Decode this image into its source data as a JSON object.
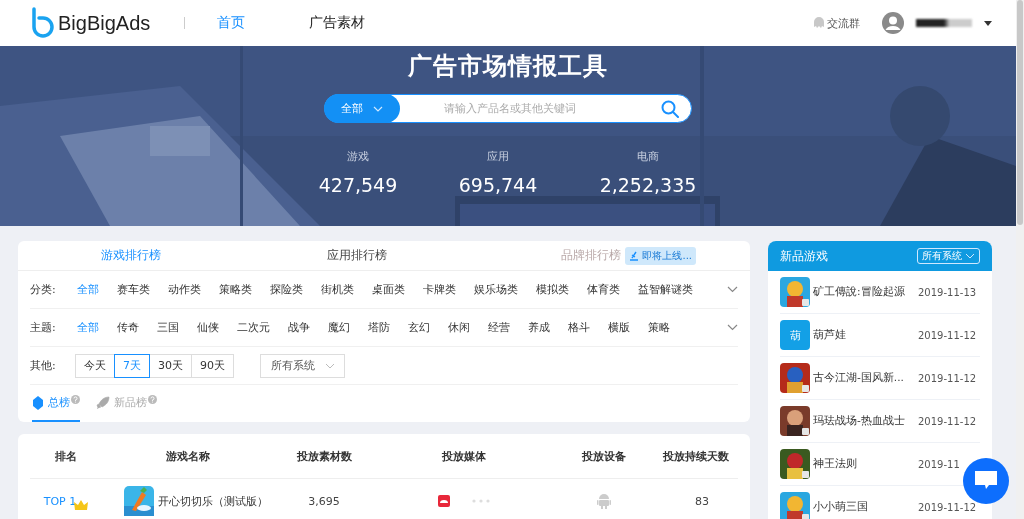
{
  "nav": {
    "logo": "BigBigAds",
    "items": [
      {
        "label": "首页",
        "selected": true
      },
      {
        "label": "广告素材",
        "selected": false
      }
    ],
    "group_chat": "交流群"
  },
  "hero": {
    "title": "广告市场情报工具",
    "search": {
      "scope": "全部",
      "placeholder": "请输入产品名或其他关键词"
    },
    "stats": [
      {
        "label": "游戏",
        "value": "427,549"
      },
      {
        "label": "应用",
        "value": "695,744"
      },
      {
        "label": "电商",
        "value": "2,252,335"
      }
    ]
  },
  "rank_tabs": [
    {
      "label": "游戏排行榜",
      "selected": true,
      "disabled": false
    },
    {
      "label": "应用排行榜",
      "selected": false,
      "disabled": false
    },
    {
      "label": "品牌排行榜",
      "selected": false,
      "disabled": true,
      "badge": "即将上线..."
    }
  ],
  "filters": [
    {
      "label": "分类:",
      "options": [
        {
          "label": "全部",
          "selected": true
        },
        {
          "label": "赛车类",
          "selected": false
        },
        {
          "label": "动作类",
          "selected": false
        },
        {
          "label": "策略类",
          "selected": false
        },
        {
          "label": "探险类",
          "selected": false
        },
        {
          "label": "街机类",
          "selected": false
        },
        {
          "label": "桌面类",
          "selected": false
        },
        {
          "label": "卡牌类",
          "selected": false
        },
        {
          "label": "娱乐场类",
          "selected": false
        },
        {
          "label": "模拟类",
          "selected": false
        },
        {
          "label": "体育类",
          "selected": false
        },
        {
          "label": "益智解谜类",
          "selected": false
        }
      ]
    },
    {
      "label": "主题:",
      "options": [
        {
          "label": "全部",
          "selected": true
        },
        {
          "label": "传奇",
          "selected": false
        },
        {
          "label": "三国",
          "selected": false
        },
        {
          "label": "仙侠",
          "selected": false
        },
        {
          "label": "二次元",
          "selected": false
        },
        {
          "label": "战争",
          "selected": false
        },
        {
          "label": "魔幻",
          "selected": false
        },
        {
          "label": "塔防",
          "selected": false
        },
        {
          "label": "玄幻",
          "selected": false
        },
        {
          "label": "休闲",
          "selected": false
        },
        {
          "label": "经营",
          "selected": false
        },
        {
          "label": "养成",
          "selected": false
        },
        {
          "label": "格斗",
          "selected": false
        },
        {
          "label": "横版",
          "selected": false
        },
        {
          "label": "策略",
          "selected": false
        }
      ]
    }
  ],
  "other": {
    "label": "其他:",
    "periods": [
      {
        "label": "今天",
        "selected": false
      },
      {
        "label": "7天",
        "selected": true
      },
      {
        "label": "30天",
        "selected": false
      },
      {
        "label": "90天",
        "selected": false
      }
    ],
    "system": "所有系统"
  },
  "sub_tabs": [
    {
      "label": "总榜",
      "selected": true
    },
    {
      "label": "新品榜",
      "selected": false
    }
  ],
  "table": {
    "columns": [
      "排名",
      "游戏名称",
      "投放素材数",
      "投放媒体",
      "投放设备",
      "投放持续天数"
    ],
    "rows": [
      {
        "rank": "TOP 1",
        "name": "开心切切乐（测试版）",
        "materials": "3,695",
        "days": "83"
      }
    ]
  },
  "new_games": {
    "title": "新品游戏",
    "system": "所有系统",
    "items": [
      {
        "name": "矿工傳說:冒险起源",
        "date": "2019-11-13"
      },
      {
        "name": "葫芦娃",
        "date": "2019-11-12",
        "icon": {
          "kind": "text",
          "text": "葫"
        }
      },
      {
        "name": "古今江湖-国风新...",
        "date": "2019-11-12"
      },
      {
        "name": "玛珐战场-热血战士",
        "date": "2019-11-12"
      },
      {
        "name": "神王法则",
        "date": "2019-11"
      },
      {
        "name": "小小萌三国",
        "date": "2019-11-12"
      }
    ]
  }
}
